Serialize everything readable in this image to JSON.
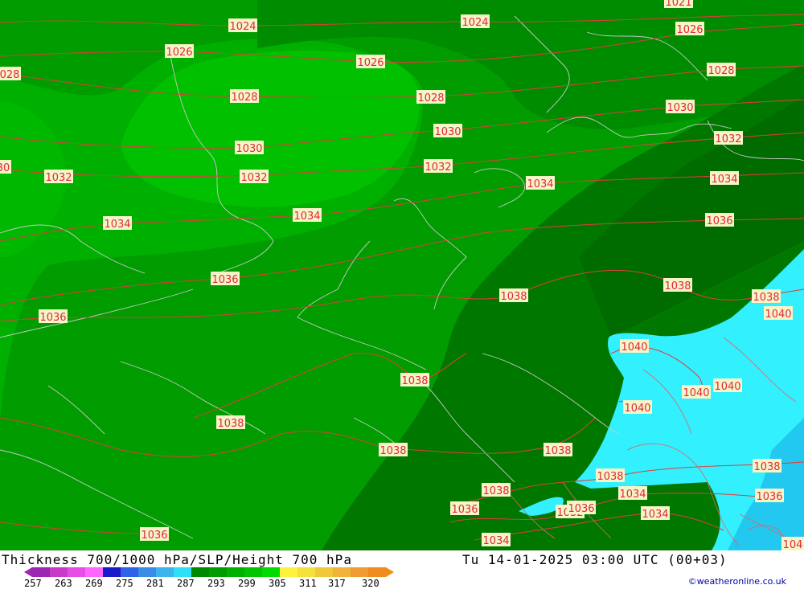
{
  "footer": {
    "title": "Thickness 700/1000 hPa/SLP/Height 700 hPa",
    "datetime": "Tu 14-01-2025 03:00 UTC (00+03)",
    "credit": "©weatheronline.co.uk"
  },
  "legend": {
    "colors": [
      "#9c27b0",
      "#c63cc9",
      "#e74ce6",
      "#ff66ff",
      "#1a1ac8",
      "#2f62e6",
      "#3a8ce6",
      "#3cb4ee",
      "#2fe0f5",
      "#008800",
      "#009c00",
      "#00b000",
      "#00c400",
      "#00dc00",
      "#fff23c",
      "#f5e03c",
      "#f0c83a",
      "#f0b43a",
      "#f09c32",
      "#f08c1e"
    ],
    "labels": [
      "257",
      "263",
      "269",
      "275",
      "281",
      "287",
      "293",
      "299",
      "305",
      "311",
      "317",
      "320"
    ]
  },
  "isobar_labels": [
    {
      "text": "1024"
    },
    {
      "text": "1024"
    },
    {
      "text": "1021"
    },
    {
      "text": "1026"
    },
    {
      "text": "1026"
    },
    {
      "text": "1026"
    },
    {
      "text": "028"
    },
    {
      "text": "1028"
    },
    {
      "text": "1028"
    },
    {
      "text": "1028"
    },
    {
      "text": "1030"
    },
    {
      "text": "1030"
    },
    {
      "text": "1030"
    },
    {
      "text": "1032"
    },
    {
      "text": "1032"
    },
    {
      "text": "1032"
    },
    {
      "text": "1032"
    },
    {
      "text": "30"
    },
    {
      "text": "1034"
    },
    {
      "text": "1034"
    },
    {
      "text": "1034"
    },
    {
      "text": "1034"
    },
    {
      "text": "1036"
    },
    {
      "text": "1036"
    },
    {
      "text": "1036"
    },
    {
      "text": "1038"
    },
    {
      "text": "1038"
    },
    {
      "text": "1038"
    },
    {
      "text": "1038"
    },
    {
      "text": "1038"
    },
    {
      "text": "1038"
    },
    {
      "text": "1038"
    },
    {
      "text": "1038"
    },
    {
      "text": "1038"
    },
    {
      "text": "1040"
    },
    {
      "text": "1040"
    },
    {
      "text": "1040"
    },
    {
      "text": "1040"
    },
    {
      "text": "1040"
    },
    {
      "text": "1038"
    },
    {
      "text": "1036"
    },
    {
      "text": "1036"
    },
    {
      "text": "1034"
    },
    {
      "text": "1034"
    },
    {
      "text": "1034"
    },
    {
      "text": "1032"
    },
    {
      "text": "1036"
    },
    {
      "text": "1036"
    },
    {
      "text": "104"
    }
  ]
}
